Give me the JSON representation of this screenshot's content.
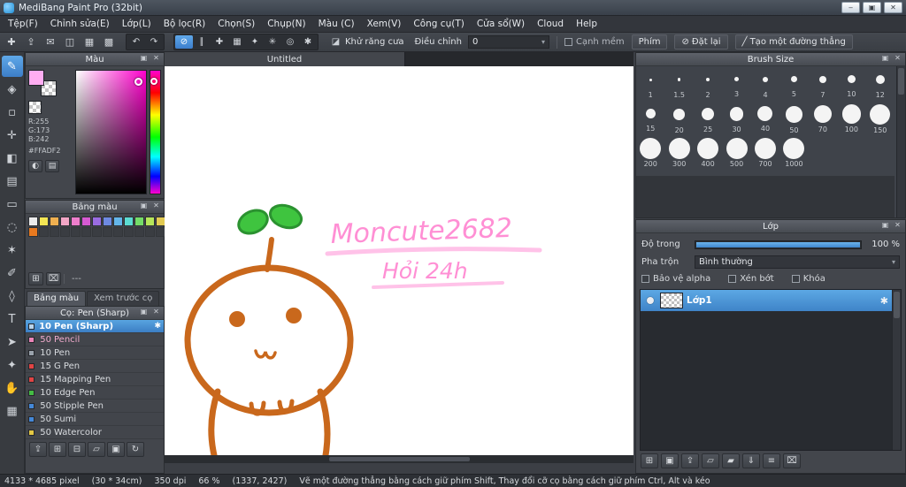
{
  "window": {
    "title": "MediBang Paint Pro (32bit)"
  },
  "window_controls": {
    "minimize": "‒",
    "restore": "▣",
    "close": "✕"
  },
  "menu": {
    "items": [
      "Tệp(F)",
      "Chỉnh sửa(E)",
      "Lớp(L)",
      "Bộ lọc(R)",
      "Chọn(S)",
      "Chụp(N)",
      "Màu (C)",
      "Xem(V)",
      "Công cụ(T)",
      "Cửa sổ(W)",
      "Cloud",
      "Help"
    ]
  },
  "icons": {
    "caret": "▾",
    "detach": "▣",
    "close": "✕",
    "undo": "↶",
    "redo": "↷",
    "gear": "✱"
  },
  "toolbar": {
    "file_icons": [
      {
        "name": "new-canvas-icon",
        "glyph": "✚"
      },
      {
        "name": "upload-icon",
        "glyph": "⇪"
      },
      {
        "name": "comment-icon",
        "glyph": "✉"
      },
      {
        "name": "save-icon",
        "glyph": "◫"
      },
      {
        "name": "grid-view-icon",
        "glyph": "▦"
      },
      {
        "name": "material-panel-icon",
        "glyph": "▩"
      }
    ],
    "snap_icons": [
      {
        "name": "snap-off-icon",
        "glyph": "⊘"
      },
      {
        "name": "snap-parallel-icon",
        "glyph": "∥"
      },
      {
        "name": "snap-cross-icon",
        "glyph": "✚"
      },
      {
        "name": "snap-grid-icon",
        "glyph": "▦"
      },
      {
        "name": "snap-vanishing-icon",
        "glyph": "✦"
      },
      {
        "name": "snap-radial-icon",
        "glyph": "✳"
      },
      {
        "name": "snap-concentric-icon",
        "glyph": "◎"
      },
      {
        "name": "snap-settings-icon",
        "glyph": "✱"
      }
    ],
    "antialias_icon": "◪",
    "antialias_label": "Khử răng cưa",
    "adjust_label": "Điều chỉnh",
    "adjust_value": "0",
    "soft_edge_label": "Cạnh mềm",
    "key_button": "Phím",
    "reset_icon": "⊘",
    "reset_button": "Đặt lại",
    "line_icon": "╱",
    "line_button": "Tạo một đường thẳng"
  },
  "tools": [
    {
      "name": "brush-tool",
      "glyph": "✎"
    },
    {
      "name": "eraser-tool",
      "glyph": "◈"
    },
    {
      "name": "dot-pen-tool",
      "glyph": "▫"
    },
    {
      "name": "move-tool",
      "glyph": "✛"
    },
    {
      "name": "fill-tool",
      "glyph": "◧"
    },
    {
      "name": "gradient-tool",
      "glyph": "▤"
    },
    {
      "name": "select-tool",
      "glyph": "▭"
    },
    {
      "name": "lasso-tool",
      "glyph": "◌"
    },
    {
      "name": "magic-wand-tool",
      "glyph": "✶"
    },
    {
      "name": "select-pen-tool",
      "glyph": "✐"
    },
    {
      "name": "select-eraser-tool",
      "glyph": "◊"
    },
    {
      "name": "text-tool",
      "glyph": "T"
    },
    {
      "name": "operation-tool",
      "glyph": "➤"
    },
    {
      "name": "eyedropper-tool",
      "glyph": "✦"
    },
    {
      "name": "hand-tool",
      "glyph": "✋"
    },
    {
      "name": "divide-tool",
      "glyph": "▦"
    }
  ],
  "color_panel": {
    "title": "Màu",
    "fg": "#FFADF2",
    "r": "R:255",
    "g": "G:173",
    "b": "B:242",
    "hex": "#FFADF2",
    "wheel_button": "◐",
    "slider_button": "▤"
  },
  "palette_panel": {
    "title": "Bảng màu",
    "row1": [
      "#ececec",
      "#f4e654",
      "#f0b050",
      "#f2a6c6",
      "#ee7ecc",
      "#d65ad2",
      "#9a6ce2",
      "#6e8ae2",
      "#64b6ea",
      "#5cdcd2",
      "#74dc68",
      "#b6e65a",
      "#e2ca52"
    ],
    "row2": [
      "#e8791f"
    ],
    "name": "---",
    "add": "⊞",
    "del": "⌧"
  },
  "left_tabs": {
    "palette": "Bảng màu",
    "brush_preview": "Xem trước cọ"
  },
  "brush_panel": {
    "title": "Cọ: Pen (Sharp)",
    "brushes": [
      {
        "size": "10",
        "name": "Pen (Sharp)",
        "chip": "#b8d4ec"
      },
      {
        "size": "50",
        "name": "Pencil",
        "chip": "#ec84b8",
        "text": "#efaacb"
      },
      {
        "size": "10",
        "name": "Pen",
        "chip": "#9aa2ac"
      },
      {
        "size": "15",
        "name": "G Pen",
        "chip": "#e04444"
      },
      {
        "size": "15",
        "name": "Mapping Pen",
        "chip": "#e04444"
      },
      {
        "size": "10",
        "name": "Edge Pen",
        "chip": "#44bc44"
      },
      {
        "size": "50",
        "name": "Stipple Pen",
        "chip": "#4488d8"
      },
      {
        "size": "50",
        "name": "Sumi",
        "chip": "#4488d8"
      },
      {
        "size": "50",
        "name": "Watercolor",
        "chip": "#e4c844"
      }
    ],
    "footer": [
      {
        "name": "upload-brush-button",
        "glyph": "⇪"
      },
      {
        "name": "add-brush-button",
        "glyph": "⊞"
      },
      {
        "name": "brush-menu-button",
        "glyph": "⊟"
      },
      {
        "name": "brush-folder-button",
        "glyph": "▱"
      },
      {
        "name": "duplicate-brush-button",
        "glyph": "▣"
      },
      {
        "name": "reload-brush-button",
        "glyph": "↻"
      }
    ]
  },
  "brush_size_panel": {
    "title": "Brush Size",
    "sizes": [
      "1",
      "1.5",
      "2",
      "3",
      "4",
      "5",
      "7",
      "10",
      "12",
      "15",
      "20",
      "25",
      "30",
      "40",
      "50",
      "70",
      "100",
      "150",
      "200",
      "300",
      "400",
      "500",
      "700",
      "1000"
    ]
  },
  "layer_panel": {
    "title": "Lớp",
    "opacity_label": "Độ trong",
    "opacity_value": "100 %",
    "blend_label": "Pha trộn",
    "blend_value": "Bình thường",
    "alpha_label": "Bảo vệ alpha",
    "clip_label": "Xén bớt",
    "lock_label": "Khóa",
    "layers": [
      {
        "name": "Lớp1"
      }
    ],
    "footer": [
      {
        "name": "add-layer-button",
        "glyph": "⊞"
      },
      {
        "name": "duplicate-layer-button",
        "glyph": "▣"
      },
      {
        "name": "import-layer-button",
        "glyph": "⇪"
      },
      {
        "name": "add-layer-folder-button",
        "glyph": "▱"
      },
      {
        "name": "layer-folder-button",
        "glyph": "▰"
      },
      {
        "name": "merge-down-button",
        "glyph": "⇓"
      },
      {
        "name": "flatten-button",
        "glyph": "≡"
      },
      {
        "name": "delete-layer-button",
        "glyph": "⌧"
      }
    ]
  },
  "canvas": {
    "tab": "Untitled",
    "text1": "Moncute2682",
    "text2": "Hỏi 24h",
    "ink": "#c9681c",
    "leaf": "#3fc43f",
    "text_color": "#ff8fd4"
  },
  "status": {
    "size": "4133 * 4685 pixel",
    "cm": "(30 * 34cm)",
    "dpi": "350 dpi",
    "zoom": "66 %",
    "coords": "(1337, 2427)",
    "hint": "Vẽ một đường thẳng bằng cách giữ phím Shift, Thay đổi cỡ cọ bằng cách giữ phím Ctrl, Alt và kéo"
  }
}
